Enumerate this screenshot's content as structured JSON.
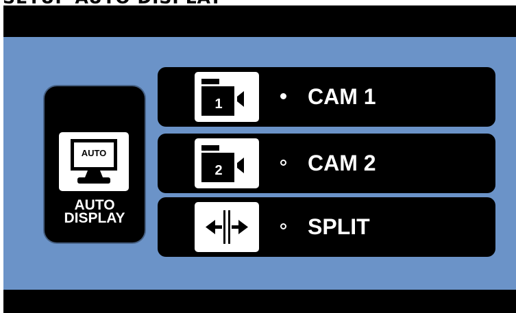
{
  "header": {
    "title": "SETUP AUTO DISPLAY"
  },
  "auto_display": {
    "icon": "monitor-auto-icon",
    "icon_text": "AUTO",
    "label_line1": "AUTO",
    "label_line2": "DISPLAY"
  },
  "options": [
    {
      "id": "cam1",
      "label": "CAM 1",
      "icon": "camera-1-icon",
      "icon_number": "1",
      "selected": true
    },
    {
      "id": "cam2",
      "label": "CAM 2",
      "icon": "camera-2-icon",
      "icon_number": "2",
      "selected": false
    },
    {
      "id": "split",
      "label": "SPLIT",
      "icon": "split-screen-icon",
      "selected": false
    }
  ],
  "colors": {
    "background_panel": "#6b93c8",
    "bars": "#000000",
    "text": "#ffffff"
  }
}
